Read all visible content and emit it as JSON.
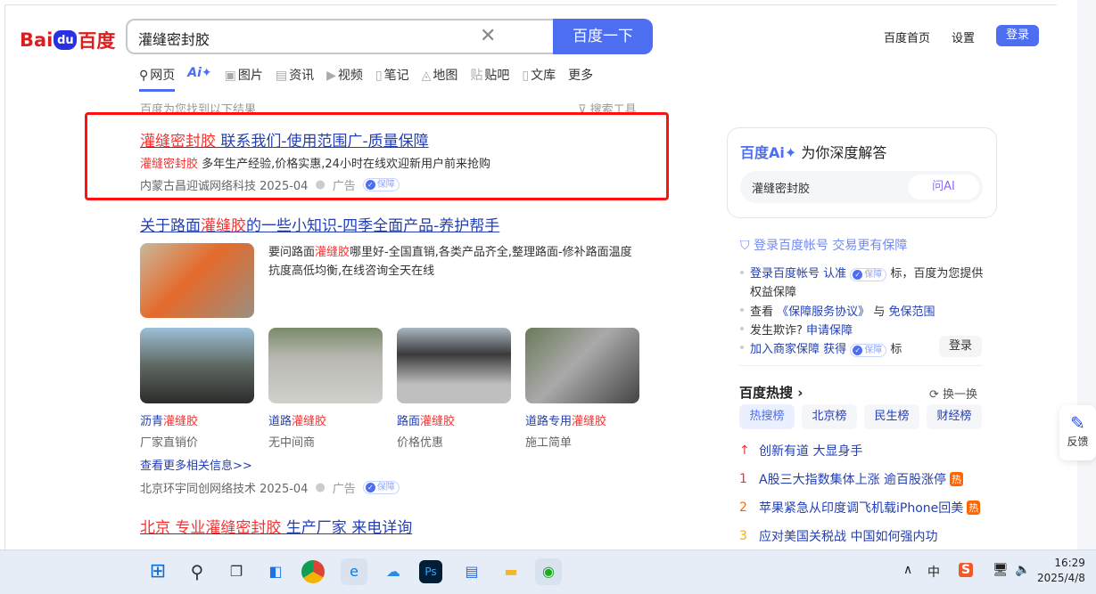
{
  "header": {
    "logo": "Bai du 百度",
    "query": "灌缝密封胶",
    "search_button": "百度一下",
    "links": [
      "百度首页",
      "设置"
    ],
    "login": "登录"
  },
  "tabs": [
    {
      "icon": "search-icon",
      "label": "网页"
    },
    {
      "icon": "ai-icon",
      "label": "Ai✦"
    },
    {
      "icon": "image-icon",
      "label": "图片"
    },
    {
      "icon": "news-icon",
      "label": "资讯"
    },
    {
      "icon": "video-icon",
      "label": "视频"
    },
    {
      "icon": "note-icon",
      "label": "笔记"
    },
    {
      "icon": "map-icon",
      "label": "地图"
    },
    {
      "icon": "tieba-icon",
      "label": "贴吧"
    },
    {
      "icon": "wenku-icon",
      "label": "文库"
    },
    {
      "icon": "",
      "label": "更多"
    }
  ],
  "found": "百度为您找到以下结果",
  "tools": "搜索工具",
  "results": [
    {
      "title_em": "灌缝密封胶",
      "title": " 联系我们-使用范围广-质量保障",
      "desc_em": "灌缝密封胶",
      "desc": " 多年生产经验,价格实惠,24小时在线欢迎新用户前来抢购",
      "source": "内蒙古昌迎诚网络科技 2025-04",
      "ad": "广告",
      "badge": "保障"
    },
    {
      "title_pre": "关于路面",
      "title_em": "灌缝胶",
      "title_post": "的一些小知识-四季全面产品-养护帮手",
      "desc_pre": "要问路面",
      "desc_em": "灌缝胶",
      "desc_post": "哪里好-全国直销,各类产品齐全,整理路面-修补路面温度抗度高低均衡,在线咨询全天在线",
      "items": [
        {
          "pre": "沥青",
          "em": "灌缝胶",
          "sub": "厂家直销价"
        },
        {
          "pre": "道路",
          "em": "灌缝胶",
          "sub": "无中间商"
        },
        {
          "pre": "路面",
          "em": "灌缝胶",
          "sub": "价格优惠"
        },
        {
          "pre": "道路专用",
          "em": "灌缝胶",
          "sub": "施工简单"
        }
      ],
      "more": "查看更多相关信息>>",
      "source": "北京环宇同创网络技术 2025-04",
      "ad": "广告",
      "badge": "保障"
    },
    {
      "title_pre": "北京 专业",
      "title_em": "灌缝密封胶",
      "title_post": " 生产厂家 来电详询"
    }
  ],
  "sidebar": {
    "ai_brand": "百度Ai✦",
    "ai_title": "为你深度解答",
    "ai_query": "灌缝密封胶",
    "ask_ai": "问AI",
    "guard_title": "登录百度帐号 交易更有保障",
    "g1a": "登录百度帐号 认准",
    "g1b": "标，百度为您提供权益保障",
    "g2a": "查看",
    "g2b": "《保障服务协议》",
    "g2c": "与",
    "g2d": "免保范围",
    "g3a": "发生欺诈?",
    "g3b": "申请保障",
    "g4a": "加入商家保障 获得",
    "g4b": "标",
    "login": "登录",
    "hot_title": "百度热搜 ›",
    "swap": "换一换",
    "chips": [
      "热搜榜",
      "北京榜",
      "民生榜",
      "财经榜"
    ],
    "hot": [
      {
        "n": "↑",
        "t": "创新有道 大显身手",
        "c": "#f73131"
      },
      {
        "n": "1",
        "t": "A股三大指数集体上涨 逾百股涨停",
        "c": "#f73131",
        "hot": "热"
      },
      {
        "n": "2",
        "t": "苹果紧急从印度调飞机载iPhone回美",
        "c": "#ff6600",
        "hot": "热"
      },
      {
        "n": "3",
        "t": "应对美国关税战 中国如何强内功",
        "c": "#faa90e"
      }
    ]
  },
  "feedback": "反馈",
  "taskbar": {
    "time": "16:29",
    "date": "2025/4/8",
    "ime": "中",
    "sogou": "S"
  }
}
